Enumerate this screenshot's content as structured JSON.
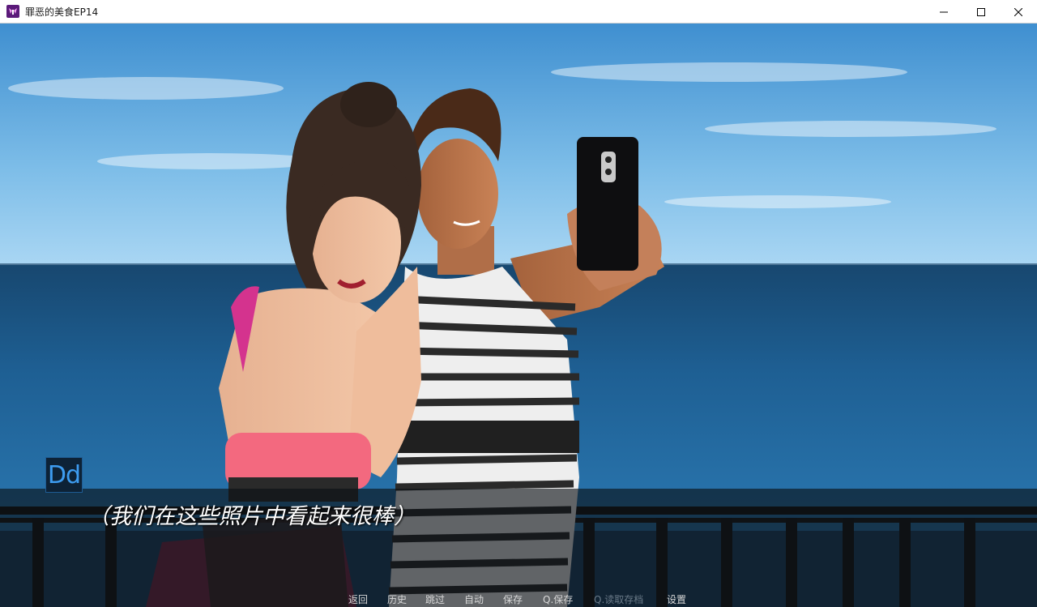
{
  "window": {
    "title": "罪恶的美食EP14",
    "controls": [
      "minimize-icon",
      "maximize-icon",
      "close-icon"
    ]
  },
  "scene": {
    "description_colors": {
      "sky": "#5fa8dc",
      "sea": "#1c5a8c",
      "railing": "#1a1a1a"
    }
  },
  "dialogue": {
    "speaker_badge": "Dd",
    "text": "（我们在这些照片中看起来很棒）"
  },
  "quick_menu": {
    "back": "返回",
    "history": "历史",
    "skip": "跳过",
    "auto": "自动",
    "save": "保存",
    "quick_save": "Q.保存",
    "quick_load": "Q.读取存档",
    "settings": "设置"
  }
}
